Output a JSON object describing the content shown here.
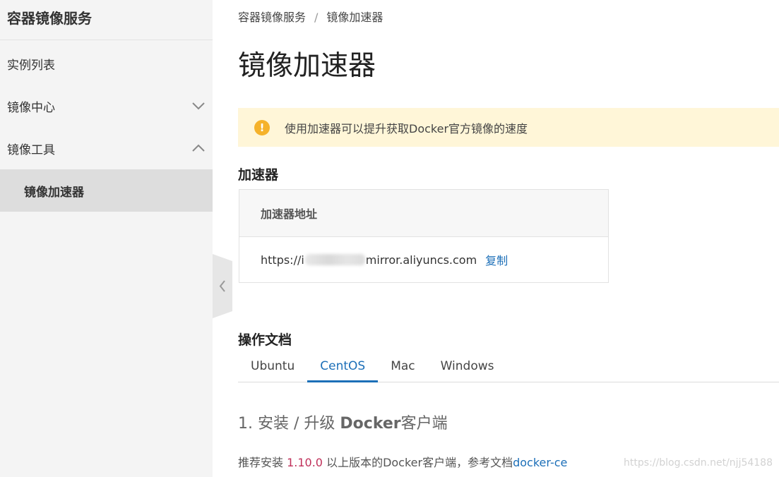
{
  "sidebar": {
    "title": "容器镜像服务",
    "items": [
      {
        "label": "实例列表"
      },
      {
        "label": "镜像中心",
        "icon": "chevron-down-icon"
      },
      {
        "label": "镜像工具",
        "icon": "chevron-up-icon"
      }
    ],
    "sub_items": [
      {
        "label": "镜像加速器",
        "active": true
      }
    ]
  },
  "breadcrumb": {
    "root": "容器镜像服务",
    "separator": "/",
    "current": "镜像加速器"
  },
  "page_title": "镜像加速器",
  "notice": {
    "icon": "!",
    "text": "使用加速器可以提升获取Docker官方镜像的速度"
  },
  "accelerator": {
    "section_title": "加速器",
    "header": "加速器地址",
    "url_prefix": "https://i",
    "url_suffix": "mirror.aliyuncs.com",
    "copy_label": "复制"
  },
  "docs": {
    "section_title": "操作文档",
    "tabs": [
      {
        "label": "Ubuntu"
      },
      {
        "label": "CentOS",
        "active": true
      },
      {
        "label": "Mac"
      },
      {
        "label": "Windows"
      }
    ]
  },
  "step": {
    "number": "1.",
    "title": "安装 / 升级",
    "title_bold": "Docker",
    "title_end": "客户端",
    "text_before": "推荐安装 ",
    "version": "1.10.0",
    "text_after": " 以上版本的Docker客户端，参考文档",
    "link": "docker-ce"
  },
  "watermark": "https://blog.csdn.net/njj54188",
  "colors": {
    "accent": "#1c6fb8",
    "notice_bg": "#fff6d8",
    "warn_icon": "#f5b22b",
    "sidebar_bg": "#f4f4f4",
    "version_text": "#c0305a"
  }
}
